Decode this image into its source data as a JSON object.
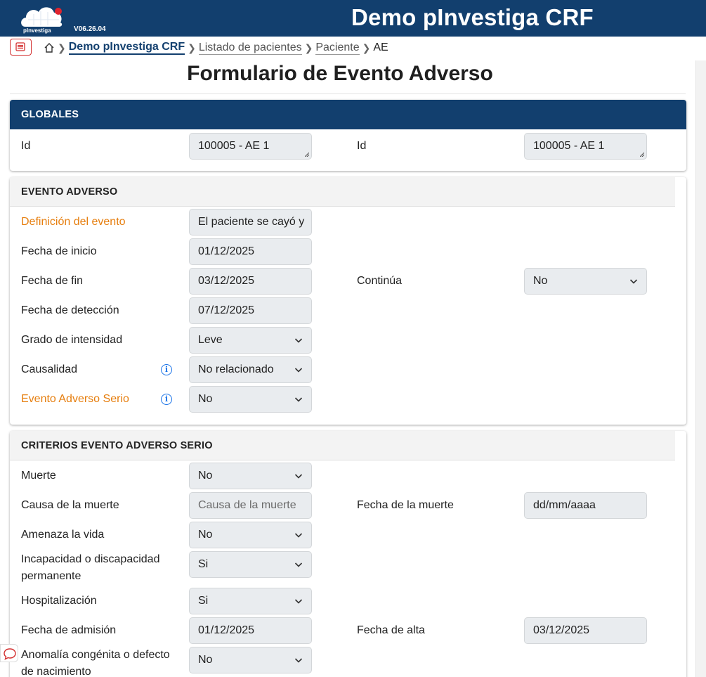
{
  "header": {
    "logo_text": "pInvestiga",
    "version": "V06.26.04",
    "app_title": "Demo pInvestiga CRF"
  },
  "breadcrumb": {
    "items": [
      "Demo pInvestiga CRF",
      "Listado de pacientes",
      "Paciente",
      "AE"
    ]
  },
  "page_title": "Formulario de Evento Adverso",
  "globales": {
    "title": "GLOBALES",
    "id_label_1": "Id",
    "id_value_1": "100005 - AE 1",
    "id_label_2": "Id",
    "id_value_2": "100005 - AE 1"
  },
  "evento": {
    "title": "EVENTO ADVERSO",
    "definicion_label": "Definición del evento",
    "definicion_value": "El paciente se cayó y",
    "fecha_inicio_label": "Fecha de inicio",
    "fecha_inicio_value": "01/12/2025",
    "fecha_fin_label": "Fecha de fin",
    "fecha_fin_value": "03/12/2025",
    "continua_label": "Continúa",
    "continua_value": "No",
    "fecha_deteccion_label": "Fecha de detección",
    "fecha_deteccion_value": "07/12/2025",
    "grado_label": "Grado de intensidad",
    "grado_value": "Leve",
    "causalidad_label": "Causalidad",
    "causalidad_value": "No relacionado",
    "serio_label": "Evento Adverso Serio",
    "serio_value": "No"
  },
  "criterios": {
    "title": "CRITERIOS EVENTO ADVERSO SERIO",
    "muerte_label": "Muerte",
    "muerte_value": "No",
    "causa_label": "Causa de la muerte",
    "causa_placeholder": "Causa de la muerte",
    "fecha_muerte_label": "Fecha de la muerte",
    "fecha_muerte_placeholder": "dd/mm/aaaa",
    "amenaza_label": "Amenaza la vida",
    "amenaza_value": "No",
    "incapacidad_label_1": "Incapacidad o discapacidad",
    "incapacidad_label_2": "permanente",
    "incapacidad_value": "Si",
    "hosp_label": "Hospitalización",
    "hosp_value": "Si",
    "admision_label": "Fecha de admisión",
    "admision_value": "01/12/2025",
    "alta_label": "Fecha de alta",
    "alta_value": "03/12/2025",
    "anomalia_label_1": "Anomalía congénita o defecto",
    "anomalia_label_2": "de nacimiento",
    "anomalia_value": "No"
  },
  "colors": {
    "header_bg": "#123f6e",
    "required_label": "#e67e0e",
    "info_icon": "#1a73e8",
    "menu_button": "#d32f2f"
  },
  "icons": [
    "logo-cloud-icon",
    "menu-icon",
    "home-icon",
    "chevron-right-icon",
    "chevron-down-icon",
    "info-icon",
    "chat-icon"
  ]
}
